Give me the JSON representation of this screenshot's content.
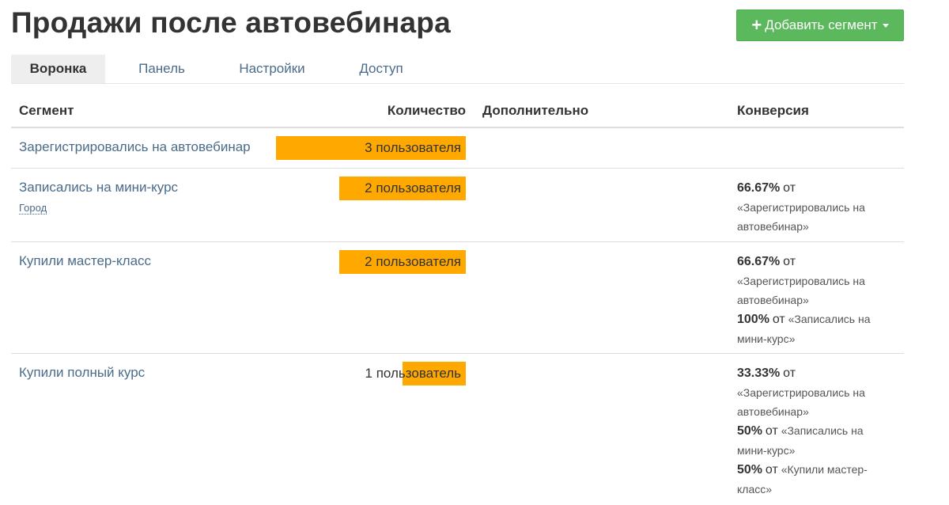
{
  "page_title": "Продажи после автовебинара",
  "add_segment_button": {
    "icon": "plus-icon",
    "label": "Добавить сегмент"
  },
  "tabs": [
    {
      "label": "Воронка",
      "active": true
    },
    {
      "label": "Панель",
      "active": false
    },
    {
      "label": "Настройки",
      "active": false
    },
    {
      "label": "Доступ",
      "active": false
    }
  ],
  "table": {
    "headers": {
      "segment": "Сегмент",
      "count": "Количество",
      "additional": "Дополнительно",
      "conversion": "Конверсия"
    },
    "rows": [
      {
        "segment": "Зарегистрировались на автовебинар",
        "count_text": "3 пользователя",
        "count_fraction": 1.0,
        "conversions": []
      },
      {
        "segment": "Записались на мини-курс",
        "sublink": "Город",
        "count_text": "2 пользователя",
        "count_fraction": 0.6667,
        "conversions": [
          {
            "percent": "66.67%",
            "from_word": "от",
            "target": "«Зарегистрировались на автовебинар»"
          }
        ]
      },
      {
        "segment": "Купили мастер-класс",
        "count_text": "2 пользователя",
        "count_fraction": 0.6667,
        "conversions": [
          {
            "percent": "66.67%",
            "from_word": "от",
            "target": "«Зарегистрировались на автовебинар»"
          },
          {
            "percent": "100%",
            "from_word": "от",
            "target": "«Записались на мини-курс»"
          }
        ]
      },
      {
        "segment": "Купили полный курс",
        "count_text": "1 пользователь",
        "count_fraction": 0.3333,
        "conversions": [
          {
            "percent": "33.33%",
            "from_word": "от",
            "target": "«Зарегистрировались на автовебинар»"
          },
          {
            "percent": "50%",
            "from_word": "от",
            "target": "«Записались на мини-курс»"
          },
          {
            "percent": "50%",
            "from_word": "от",
            "target": "«Купили мастер-класс»"
          }
        ]
      }
    ]
  },
  "colors": {
    "bar": "#ffa800",
    "button": "#5cb85c",
    "link": "#4a6b8a"
  }
}
